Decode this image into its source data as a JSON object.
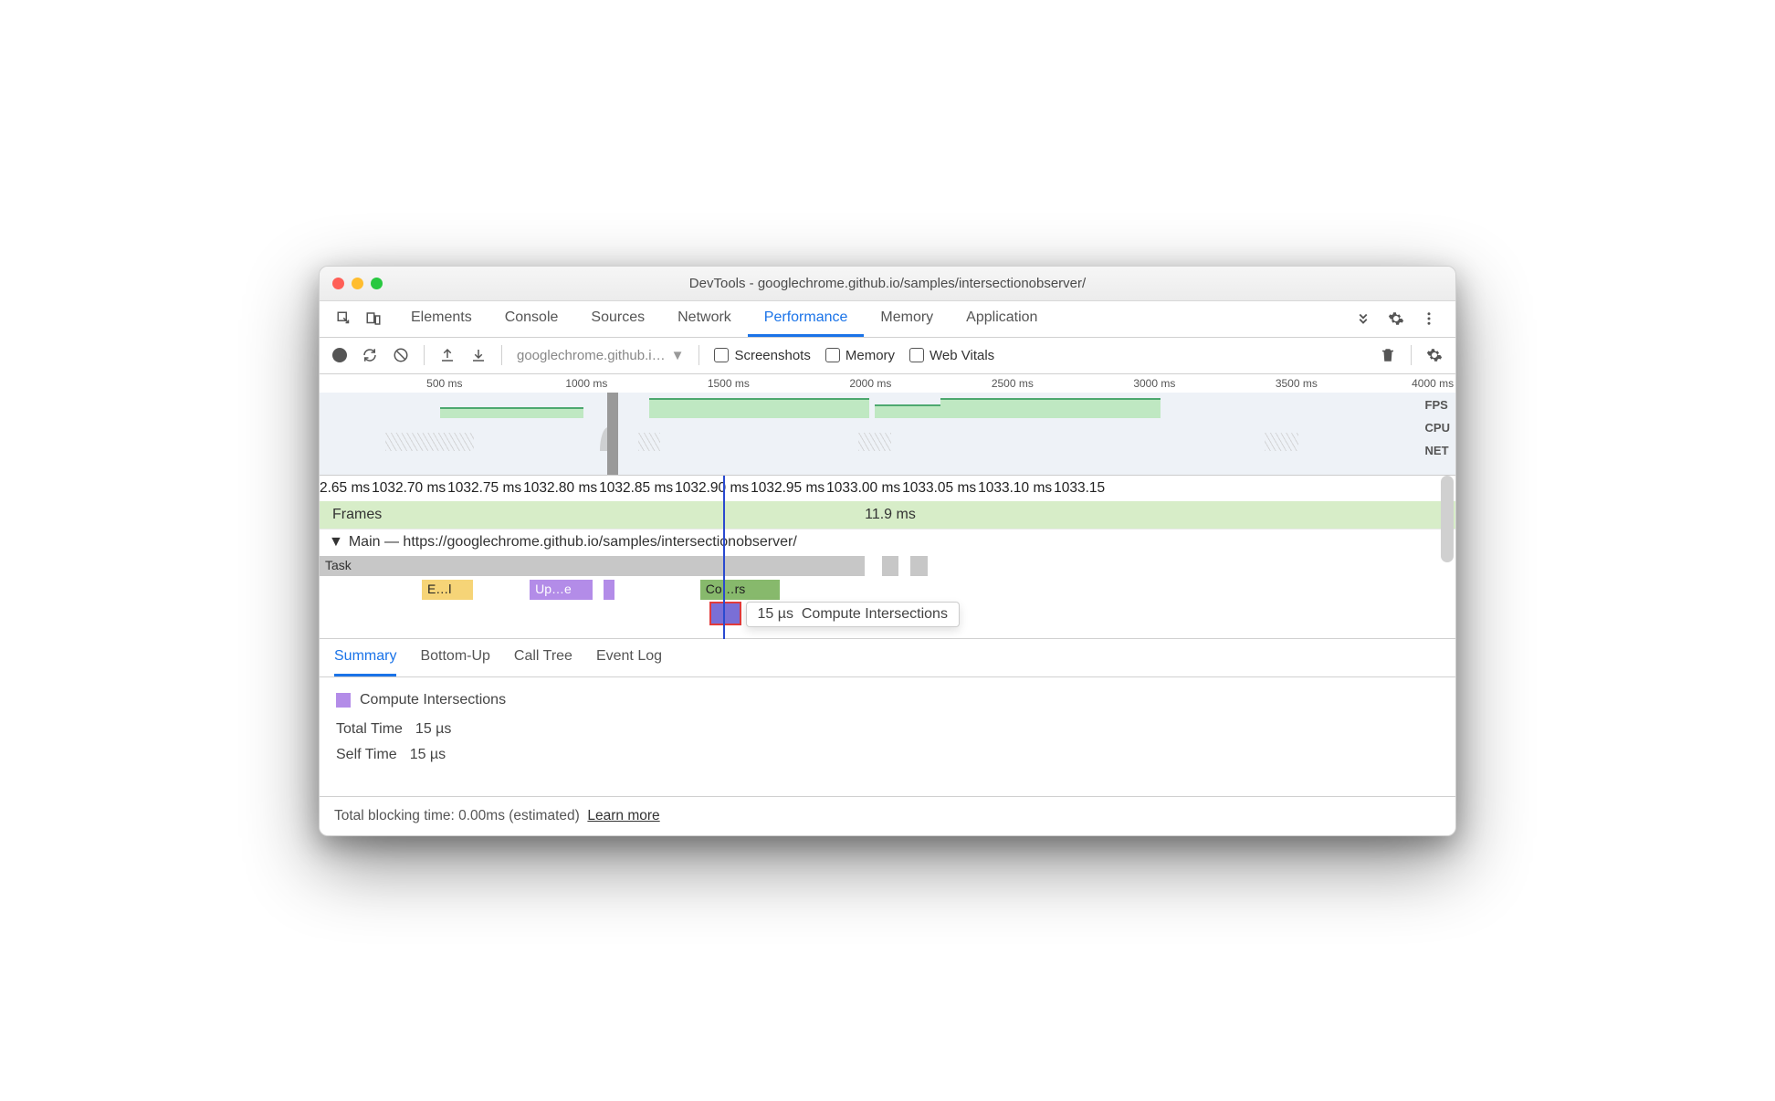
{
  "window": {
    "title": "DevTools - googlechrome.github.io/samples/intersectionobserver/"
  },
  "tabs": {
    "items": [
      "Elements",
      "Console",
      "Sources",
      "Network",
      "Performance",
      "Memory",
      "Application"
    ],
    "active_index": 4
  },
  "toolbar": {
    "page_select": "googlechrome.github.i…",
    "checkboxes": {
      "screenshots": "Screenshots",
      "memory": "Memory",
      "web_vitals": "Web Vitals"
    }
  },
  "overview": {
    "ruler": [
      "500 ms",
      "1000 ms",
      "1500 ms",
      "2000 ms",
      "2500 ms",
      "3000 ms",
      "3500 ms",
      "4000 ms"
    ],
    "lane_labels": {
      "fps": "FPS",
      "cpu": "CPU",
      "net": "NET"
    }
  },
  "detail_ruler": [
    "2.65 ms",
    "1032.70 ms",
    "1032.75 ms",
    "1032.80 ms",
    "1032.85 ms",
    "1032.90 ms",
    "1032.95 ms",
    "1033.00 ms",
    "1033.05 ms",
    "1033.10 ms",
    "1033.15"
  ],
  "lanes": {
    "frames_label": "Frames",
    "frames_duration": "11.9 ms",
    "main_label": "Main — https://googlechrome.github.io/samples/intersectionobserver/",
    "task_label": "Task",
    "chips": {
      "e": "E…l",
      "up": "Up…e",
      "co": "Co…rs"
    }
  },
  "tooltip": {
    "time": "15 µs",
    "label": "Compute Intersections"
  },
  "detail_tabs": {
    "items": [
      "Summary",
      "Bottom-Up",
      "Call Tree",
      "Event Log"
    ],
    "active_index": 0
  },
  "summary": {
    "event_name": "Compute Intersections",
    "total_time_label": "Total Time",
    "total_time_value": "15 µs",
    "self_time_label": "Self Time",
    "self_time_value": "15 µs"
  },
  "footer": {
    "text": "Total blocking time: 0.00ms (estimated)",
    "link": "Learn more"
  }
}
